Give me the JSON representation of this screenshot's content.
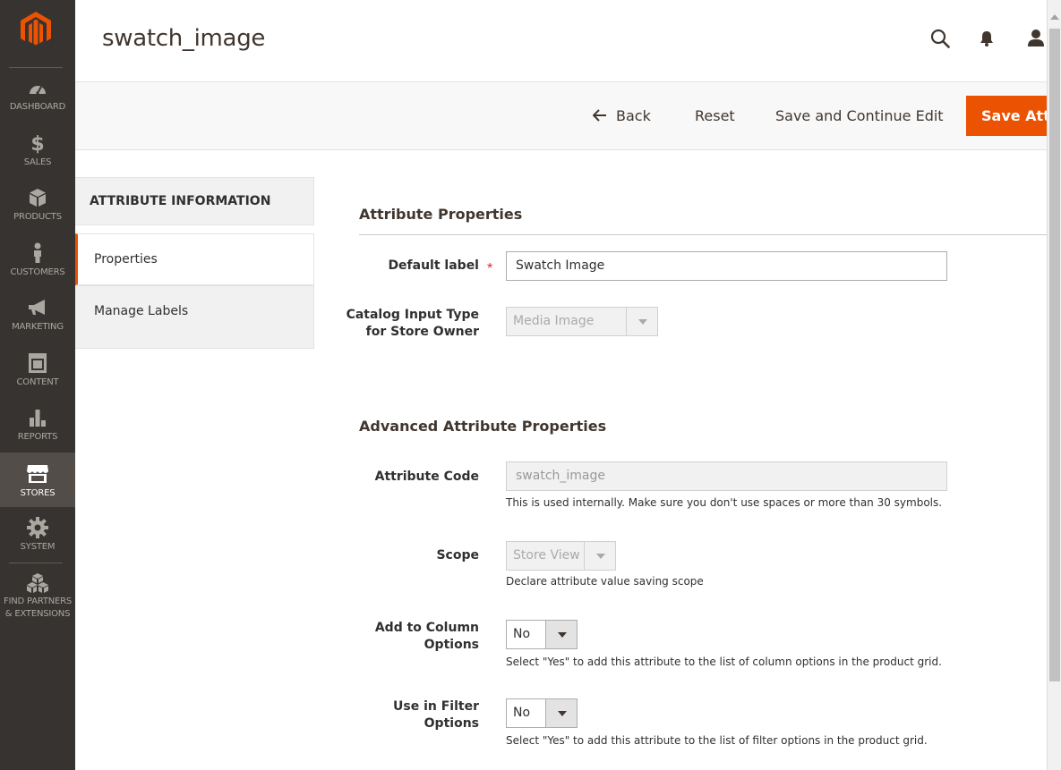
{
  "sidebar": {
    "items": [
      {
        "label": "DASHBOARD",
        "icon": "dashboard-icon"
      },
      {
        "label": "SALES",
        "icon": "dollar-icon"
      },
      {
        "label": "PRODUCTS",
        "icon": "box-icon"
      },
      {
        "label": "CUSTOMERS",
        "icon": "person-icon"
      },
      {
        "label": "MARKETING",
        "icon": "megaphone-icon"
      },
      {
        "label": "CONTENT",
        "icon": "layout-icon"
      },
      {
        "label": "REPORTS",
        "icon": "bar-chart-icon"
      },
      {
        "label": "STORES",
        "icon": "store-icon",
        "active": true
      },
      {
        "label": "SYSTEM",
        "icon": "gear-icon"
      },
      {
        "label_line1": "FIND PARTNERS",
        "label_line2": "& EXTENSIONS",
        "icon": "cubes-icon"
      }
    ]
  },
  "header": {
    "title": "swatch_image"
  },
  "actions": {
    "back": "Back",
    "reset": "Reset",
    "save_continue": "Save and Continue Edit",
    "save": "Save Attribute"
  },
  "tabs": {
    "heading": "ATTRIBUTE INFORMATION",
    "items": [
      {
        "label": "Properties",
        "active": true
      },
      {
        "label": "Manage Labels"
      }
    ]
  },
  "form": {
    "section1_title": "Attribute Properties",
    "default_label": {
      "label": "Default label",
      "value": "Swatch Image"
    },
    "input_type": {
      "label_line1": "Catalog Input Type",
      "label_line2": "for Store Owner",
      "value": "Media Image"
    },
    "section2_title": "Advanced Attribute Properties",
    "attribute_code": {
      "label": "Attribute Code",
      "value": "swatch_image",
      "note": "This is used internally. Make sure you don't use spaces or more than 30 symbols."
    },
    "scope": {
      "label": "Scope",
      "value": "Store View",
      "note": "Declare attribute value saving scope"
    },
    "column_options": {
      "label_line1": "Add to Column",
      "label_line2": "Options",
      "value": "No",
      "note": "Select \"Yes\" to add this attribute to the list of column options in the product grid."
    },
    "filter_options": {
      "label_line1": "Use in Filter",
      "label_line2": "Options",
      "value": "No",
      "note": "Select \"Yes\" to add this attribute to the list of filter options in the product grid."
    }
  },
  "colors": {
    "accent": "#eb5202",
    "sidebar_bg": "#373330",
    "sidebar_active": "#524d49"
  }
}
